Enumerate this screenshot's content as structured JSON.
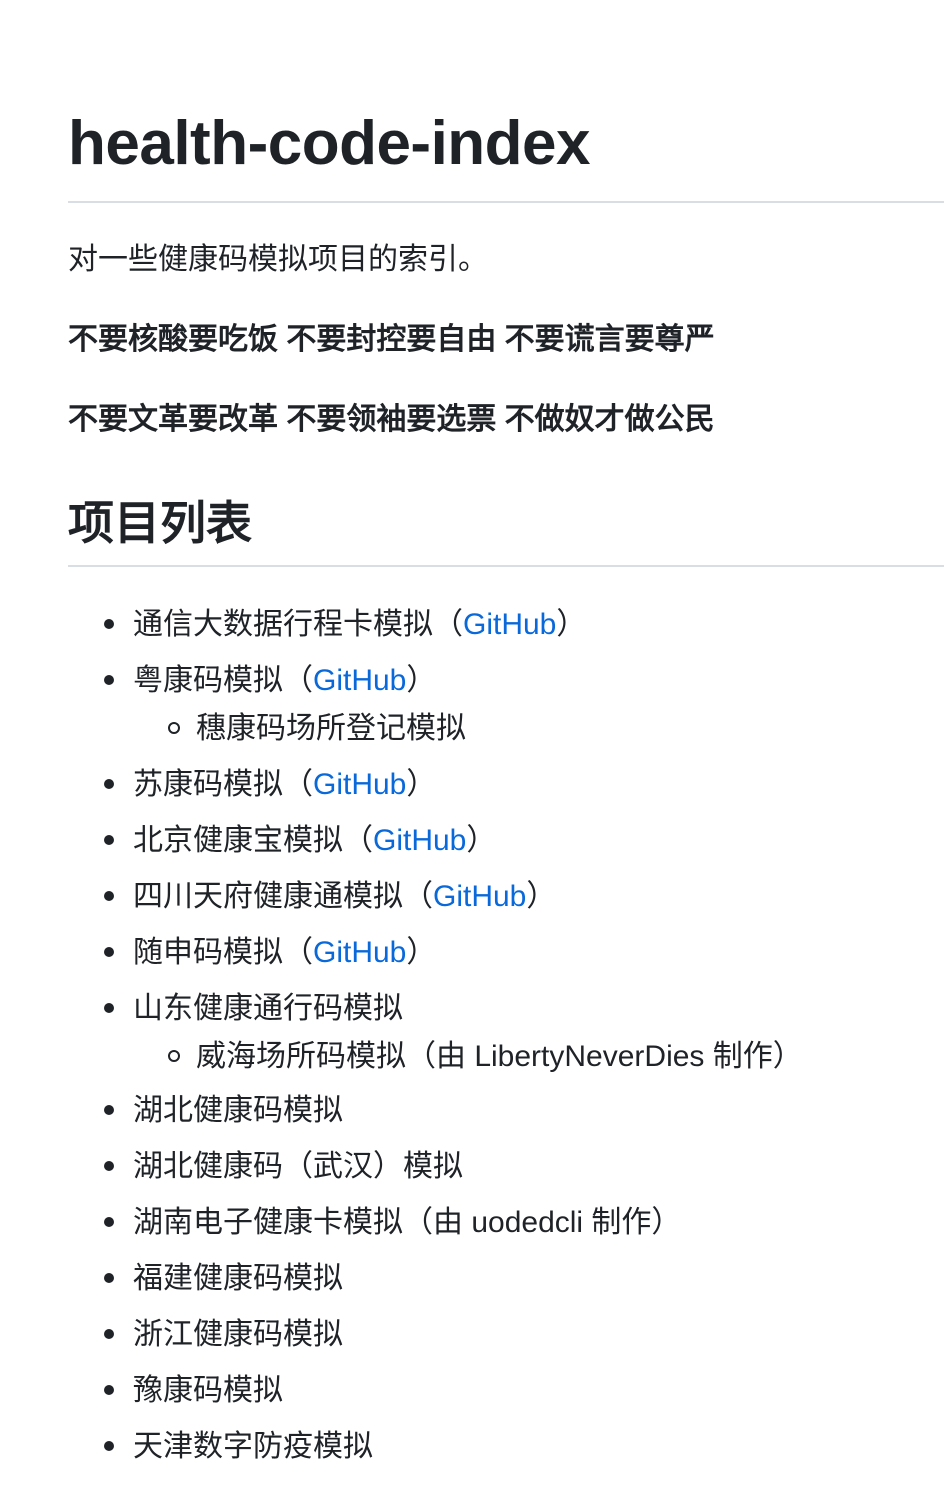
{
  "title": "health-code-index",
  "intro": "对一些健康码模拟项目的索引。",
  "slogans": [
    "不要核酸要吃饭 不要封控要自由 不要谎言要尊严",
    "不要文革要改革 不要领袖要选票 不做奴才做公民"
  ],
  "section_heading": "项目列表",
  "link_color": "#0969da",
  "projects": [
    {
      "name": "通信大数据行程卡模拟",
      "open": "（",
      "link": "GitHub",
      "close": "）"
    },
    {
      "name": "粤康码模拟",
      "open": "（",
      "link": "GitHub",
      "close": "）",
      "sub": "穗康码场所登记模拟"
    },
    {
      "name": "苏康码模拟",
      "open": "（",
      "link": "GitHub",
      "close": "）"
    },
    {
      "name": "北京健康宝模拟",
      "open": "（",
      "link": "GitHub",
      "close": "）"
    },
    {
      "name": "四川天府健康通模拟",
      "open": "（",
      "link": "GitHub",
      "close": "）"
    },
    {
      "name": "随申码模拟",
      "open": "（",
      "link": "GitHub",
      "close": "）"
    },
    {
      "name": "山东健康通行码模拟",
      "sub": "威海场所码模拟（由 LibertyNeverDies 制作）"
    },
    {
      "name": "湖北健康码模拟"
    },
    {
      "name": "湖北健康码（武汉）模拟"
    },
    {
      "name": "湖南电子健康卡模拟（由 uodedcli 制作）"
    },
    {
      "name": "福建健康码模拟"
    },
    {
      "name": "浙江健康码模拟"
    },
    {
      "name": "豫康码模拟"
    },
    {
      "name": "天津数字防疫模拟"
    }
  ]
}
